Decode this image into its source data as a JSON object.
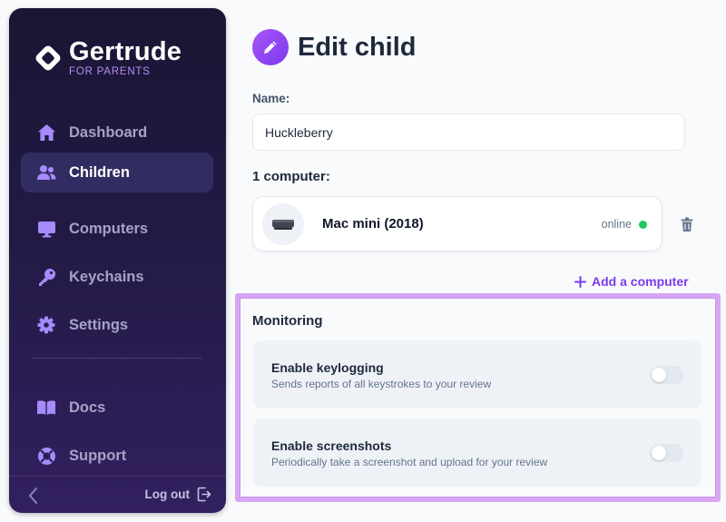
{
  "sidebar": {
    "brand": {
      "name": "Gertrude",
      "tagline": "FOR PARENTS"
    },
    "nav": [
      {
        "label": "Dashboard",
        "icon": "home-icon",
        "active": false
      },
      {
        "label": "Children",
        "icon": "users-icon",
        "active": true
      },
      {
        "label": "Computers",
        "icon": "monitor-icon",
        "active": false
      },
      {
        "label": "Keychains",
        "icon": "key-icon",
        "active": false
      },
      {
        "label": "Settings",
        "icon": "gear-icon",
        "active": false
      }
    ],
    "secondary_nav": [
      {
        "label": "Docs",
        "icon": "book-icon"
      },
      {
        "label": "Support",
        "icon": "lifebuoy-icon"
      }
    ],
    "footer": {
      "logout_label": "Log out"
    }
  },
  "main": {
    "title": "Edit child",
    "name_label": "Name:",
    "name_value": "Huckleberry",
    "computers_heading": "1 computer:",
    "computers": [
      {
        "name": "Mac mini (2018)",
        "status": "online"
      }
    ],
    "add_computer_label": "Add a computer",
    "monitoring": {
      "title": "Monitoring",
      "options": [
        {
          "title": "Enable keylogging",
          "description": "Sends reports of all keystrokes to your review",
          "enabled": false
        },
        {
          "title": "Enable screenshots",
          "description": "Periodically take a screenshot and upload for your review",
          "enabled": false
        }
      ]
    }
  },
  "colors": {
    "accent": "#7c3aed",
    "online": "#22c55e",
    "highlight_border": "#d8a6f2"
  }
}
